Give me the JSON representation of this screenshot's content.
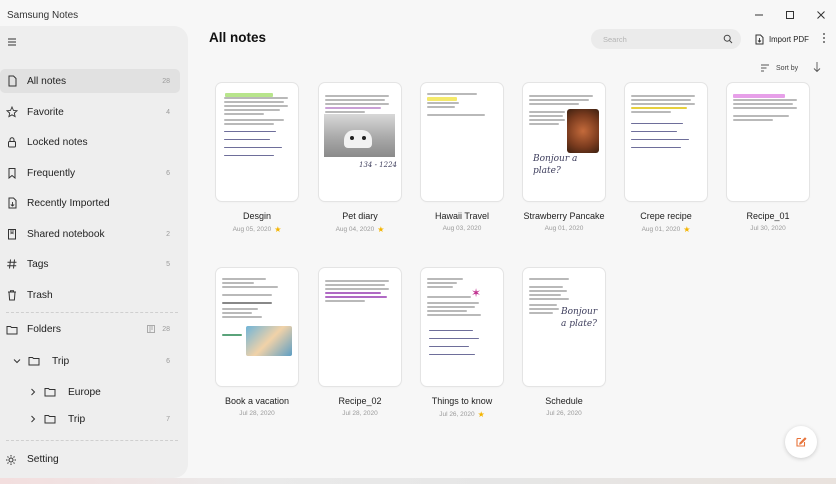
{
  "window": {
    "title": "Samsung Notes"
  },
  "colors": {
    "accent": "#e8733a",
    "star": "#f4b400",
    "handwriting": "#3d3d5c"
  },
  "sidebar": {
    "items": [
      {
        "label": "All notes",
        "count": "28",
        "icon": "document-icon",
        "active": true
      },
      {
        "label": "Favorite",
        "count": "4",
        "icon": "star-icon"
      },
      {
        "label": "Locked notes",
        "count": "",
        "icon": "lock-icon"
      },
      {
        "label": "Frequently",
        "count": "6",
        "icon": "bookmark-icon"
      },
      {
        "label": "Recently Imported",
        "count": "",
        "icon": "import-icon"
      },
      {
        "label": "Shared notebook",
        "count": "2",
        "icon": "share-icon"
      },
      {
        "label": "Tags",
        "count": "5",
        "icon": "hash-icon"
      },
      {
        "label": "Trash",
        "count": "",
        "icon": "trash-icon"
      }
    ],
    "folders": {
      "label": "Folders",
      "count": "28",
      "children": [
        {
          "label": "Trip",
          "count": "6"
        },
        {
          "label": "Europe",
          "count": ""
        },
        {
          "label": "Trip",
          "count": "7"
        }
      ]
    },
    "setting": {
      "label": "Setting"
    }
  },
  "main": {
    "title": "All notes",
    "search_placeholder": "Search",
    "import_label": "Import PDF",
    "sort_label": "Sort by",
    "notes": [
      {
        "title": "Desgin",
        "date": "Aug 05, 2020",
        "favorite": true
      },
      {
        "title": "Pet diary",
        "date": "Aug 04, 2020",
        "favorite": true
      },
      {
        "title": "Hawaii Travel",
        "date": "Aug 03, 2020",
        "favorite": false
      },
      {
        "title": "Strawberry Pancake",
        "date": "Aug 01, 2020",
        "favorite": false
      },
      {
        "title": "Crepe recipe",
        "date": "Aug 01, 2020",
        "favorite": true
      },
      {
        "title": "Recipe_01",
        "date": "Jul 30, 2020",
        "favorite": false
      },
      {
        "title": "Book a vacation",
        "date": "Jul 28, 2020",
        "favorite": false
      },
      {
        "title": "Recipe_02",
        "date": "Jul 28, 2020",
        "favorite": false
      },
      {
        "title": "Things to know",
        "date": "Jul 26, 2020",
        "favorite": true
      },
      {
        "title": "Schedule",
        "date": "Jul 26, 2020",
        "favorite": false
      }
    ],
    "handwriting": {
      "pet": "134 - 1224",
      "pancake": "Bonjour a plate?",
      "schedule": "Bonjour a plate?"
    }
  }
}
